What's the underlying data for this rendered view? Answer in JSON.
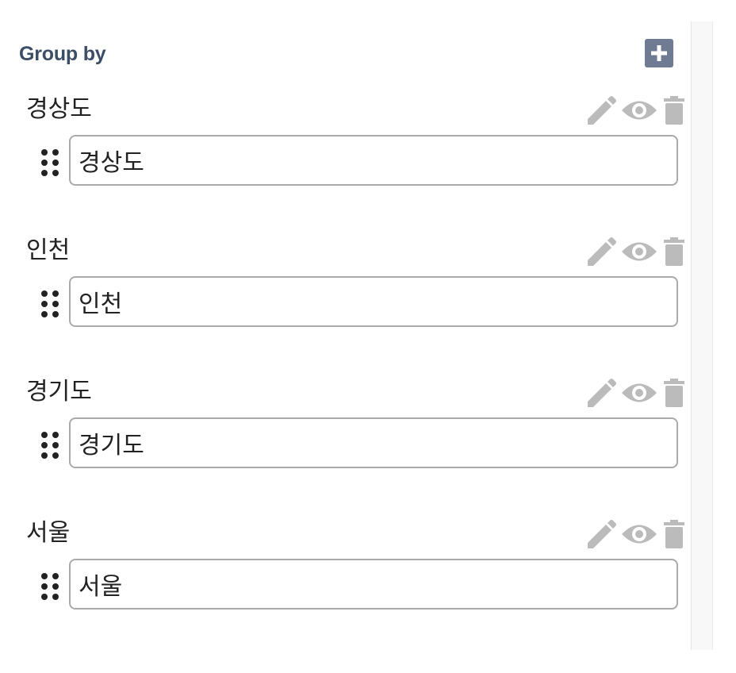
{
  "panel": {
    "title": "Group by",
    "add_button_icon": "plus-icon"
  },
  "groups": [
    {
      "label": "경상도",
      "value": "경상도"
    },
    {
      "label": "인천",
      "value": "인천"
    },
    {
      "label": "경기도",
      "value": "경기도"
    },
    {
      "label": "서울",
      "value": "서울"
    }
  ],
  "icons": {
    "edit": "pencil-icon",
    "visibility": "eye-icon",
    "delete": "trash-icon",
    "drag": "drag-handle-icon"
  },
  "colors": {
    "title": "#3c4d66",
    "add_button_bg": "#6e7b92",
    "action_icon": "#bbbbbb",
    "input_border": "#aaaaaa",
    "drag_dots": "#222222"
  }
}
